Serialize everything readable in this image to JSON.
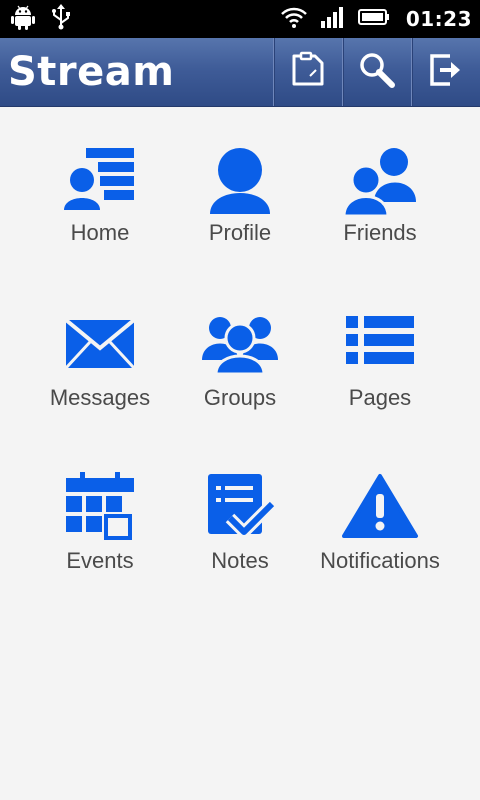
{
  "status_bar": {
    "time": "01:23",
    "icons": [
      "android-icon",
      "usb-icon",
      "wifi-icon",
      "signal-icon",
      "battery-icon"
    ]
  },
  "action_bar": {
    "title": "Stream",
    "background": "#3f5c98",
    "buttons": [
      {
        "name": "compose-icon"
      },
      {
        "name": "search-icon"
      },
      {
        "name": "logout-icon"
      }
    ]
  },
  "accent_color": "#0a5fe8",
  "menu": {
    "items": [
      {
        "label": "Home",
        "icon": "home-feed-icon"
      },
      {
        "label": "Profile",
        "icon": "profile-icon"
      },
      {
        "label": "Friends",
        "icon": "friends-icon"
      },
      {
        "label": "Messages",
        "icon": "messages-icon"
      },
      {
        "label": "Groups",
        "icon": "groups-icon"
      },
      {
        "label": "Pages",
        "icon": "pages-icon"
      },
      {
        "label": "Events",
        "icon": "events-icon"
      },
      {
        "label": "Notes",
        "icon": "notes-icon"
      },
      {
        "label": "Notifications",
        "icon": "notifications-icon"
      }
    ]
  }
}
